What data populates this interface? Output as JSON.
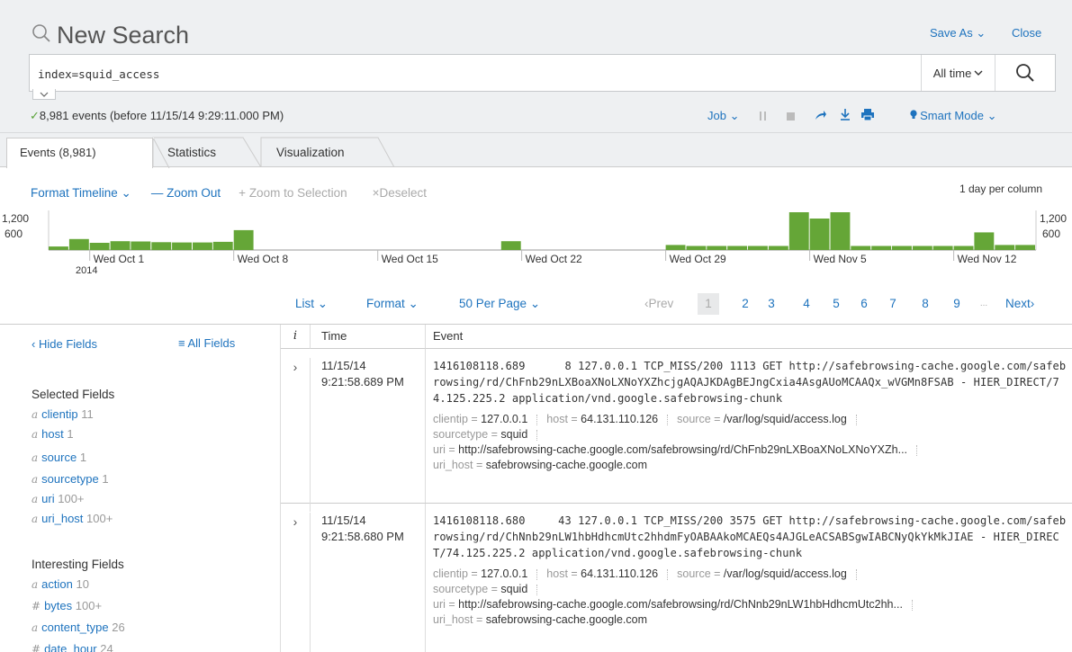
{
  "header": {
    "title": "New Search",
    "save_as": "Save As",
    "close": "Close"
  },
  "search": {
    "query": "index=squid_access",
    "time_range": "All time"
  },
  "status": {
    "check": "✓",
    "text": "8,981 events (before 11/15/14 9:29:11.000 PM)"
  },
  "job": {
    "job_label": "Job",
    "smart_mode": "Smart Mode"
  },
  "tabs": [
    {
      "label": "Events (8,981)"
    },
    {
      "label": "Statistics"
    },
    {
      "label": "Visualization"
    }
  ],
  "timeline": {
    "format": "Format Timeline",
    "zoom_out": "Zoom Out",
    "zoom_sel": "Zoom to Selection",
    "deselect": "Deselect",
    "per_column": "1 day per column",
    "y_top": "1,200",
    "y_mid": "600",
    "y_top_r": "1,200",
    "y_mid_r": "600",
    "date_labels": [
      "Wed Oct 1",
      "Wed Oct 8",
      "Wed Oct 15",
      "Wed Oct 22",
      "Wed Oct 29",
      "Wed Nov 5",
      "Wed Nov 12"
    ],
    "year": "2014",
    "bar_color": "#65a637"
  },
  "chart_data": {
    "type": "bar",
    "title": "",
    "ylim": [
      0,
      1200
    ],
    "categories": [
      "Sep 29",
      "Sep 30",
      "Oct 1",
      "Oct 2",
      "Oct 3",
      "Oct 4",
      "Oct 5",
      "Oct 6",
      "Oct 7",
      "Oct 8",
      "Oct 9",
      "Oct 10",
      "Oct 11",
      "Oct 12",
      "Oct 13",
      "Oct 14",
      "Oct 15",
      "Oct 16",
      "Oct 17",
      "Oct 18",
      "Oct 19",
      "Oct 20",
      "Oct 21",
      "Oct 22",
      "Oct 23",
      "Oct 24",
      "Oct 25",
      "Oct 26",
      "Oct 27",
      "Oct 28",
      "Oct 29",
      "Oct 30",
      "Oct 31",
      "Nov 1",
      "Nov 2",
      "Nov 3",
      "Nov 4",
      "Nov 5",
      "Nov 6",
      "Nov 7",
      "Nov 8",
      "Nov 9",
      "Nov 10",
      "Nov 11",
      "Nov 12",
      "Nov 13",
      "Nov 14",
      "Nov 15"
    ],
    "values": [
      110,
      350,
      230,
      280,
      270,
      250,
      240,
      240,
      260,
      630,
      0,
      0,
      0,
      0,
      0,
      0,
      0,
      0,
      0,
      0,
      0,
      0,
      280,
      0,
      0,
      0,
      0,
      0,
      0,
      0,
      160,
      130,
      130,
      130,
      130,
      130,
      1200,
      1000,
      1200,
      130,
      130,
      130,
      130,
      130,
      130,
      560,
      160,
      160
    ]
  },
  "pager": {
    "list": "List",
    "format": "Format",
    "per_page": "50 Per Page",
    "prev": "Prev",
    "pages": [
      "1",
      "2",
      "3",
      "4",
      "5",
      "6",
      "7",
      "8",
      "9"
    ],
    "ellipsis": "...",
    "next": "Next"
  },
  "sidebar": {
    "hide_fields": "Hide Fields",
    "all_fields": "All Fields",
    "selected_header": "Selected Fields",
    "selected": [
      {
        "type": "a",
        "name": "clientip",
        "count": "11"
      },
      {
        "type": "a",
        "name": "host",
        "count": "1"
      },
      {
        "type": "a",
        "name": "source",
        "count": "1"
      },
      {
        "type": "a",
        "name": "sourcetype",
        "count": "1"
      },
      {
        "type": "a",
        "name": "uri",
        "count": "100+"
      },
      {
        "type": "a",
        "name": "uri_host",
        "count": "100+"
      }
    ],
    "interesting_header": "Interesting Fields",
    "interesting": [
      {
        "type": "a",
        "name": "action",
        "count": "10"
      },
      {
        "type": "#",
        "name": "bytes",
        "count": "100+"
      },
      {
        "type": "a",
        "name": "content_type",
        "count": "26"
      },
      {
        "type": "#",
        "name": "date_hour",
        "count": "24"
      }
    ]
  },
  "table": {
    "col_i": "i",
    "col_time": "Time",
    "col_event": "Event",
    "events": [
      {
        "time_date": "11/15/14",
        "time_clock": "9:21:58.689 PM",
        "raw": "1416108118.689      8 127.0.0.1 TCP_MISS/200 1113 GET http://safebrowsing-cache.google.com/safebrowsing/rd/ChFnb29nLXBoaXNoLXNoYXZhcjgAQAJKDAgBEJngCxia4AsgAUoMCAAQx_wVGMn8FSAB - HIER_DIRECT/74.125.225.2 application/vnd.google.safebrowsing-chunk",
        "clientip": "127.0.0.1",
        "host": "64.131.110.126",
        "source": "/var/log/squid/access.log",
        "sourcetype": "squid",
        "uri": "http://safebrowsing-cache.google.com/safebrowsing/rd/ChFnb29nLXBoaXNoLXNoYXZh...",
        "uri_host": "safebrowsing-cache.google.com"
      },
      {
        "time_date": "11/15/14",
        "time_clock": "9:21:58.680 PM",
        "raw": "1416108118.680     43 127.0.0.1 TCP_MISS/200 3575 GET http://safebrowsing-cache.google.com/safebrowsing/rd/ChNnb29nLW1hbHdhcmUtc2hhdmFyOABAAkoMCAEQs4AJGLeACSABSgwIABCNyQkYkMkJIAE - HIER_DIRECT/74.125.225.2 application/vnd.google.safebrowsing-chunk",
        "clientip": "127.0.0.1",
        "host": "64.131.110.126",
        "source": "/var/log/squid/access.log",
        "sourcetype": "squid",
        "uri": "http://safebrowsing-cache.google.com/safebrowsing/rd/ChNnb29nLW1hbHdhcmUtc2hh...",
        "uri_host": "safebrowsing-cache.google.com"
      }
    ]
  }
}
